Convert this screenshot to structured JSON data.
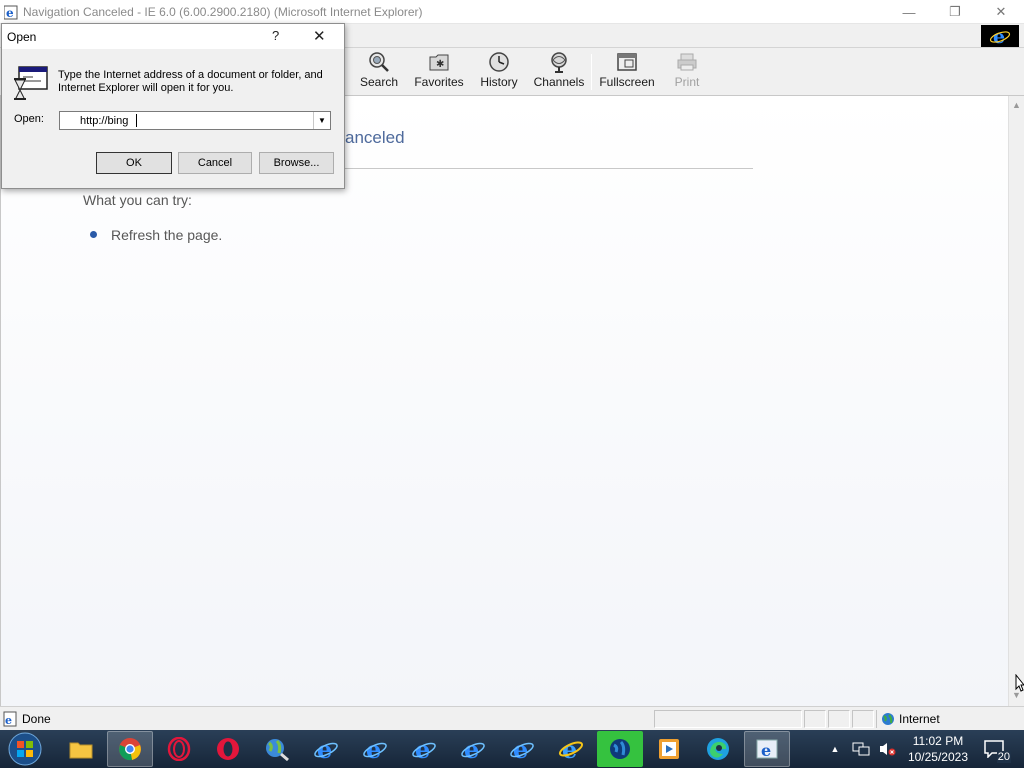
{
  "window": {
    "title": "Navigation Canceled - IE 6.0 (6.00.2900.2180) (Microsoft Internet Explorer)",
    "minimize_glyph": "—",
    "restore_glyph": "❐",
    "close_glyph": "✕"
  },
  "toolbar": {
    "buttons": [
      {
        "label": "Search",
        "icon": "search-icon"
      },
      {
        "label": "Favorites",
        "icon": "favorites-icon"
      },
      {
        "label": "History",
        "icon": "history-icon"
      },
      {
        "label": "Channels",
        "icon": "channels-icon"
      },
      {
        "label": "Fullscreen",
        "icon": "fullscreen-icon"
      },
      {
        "label": "Print",
        "icon": "print-icon",
        "disabled": true
      }
    ]
  },
  "page": {
    "heading_fragment": "anceled",
    "what_you_can_try": "What you can try:",
    "refresh": "Refresh the page."
  },
  "status": {
    "text": "Done",
    "zone": "Internet"
  },
  "taskbar": {
    "time": "11:02 PM",
    "date": "10/25/2023",
    "notification_count": "20"
  },
  "dialog": {
    "title": "Open",
    "help_glyph": "?",
    "close_glyph": "✕",
    "description": "Type the Internet address of a document or folder, and Internet Explorer will open it for you.",
    "open_label": "Open:",
    "open_value": "http://bing",
    "ok_label": "OK",
    "cancel_label": "Cancel",
    "browse_label": "Browse..."
  },
  "colors": {
    "accent": "#4e6a9c",
    "taskbar": "#1e3147",
    "bullet": "#2a5aa8"
  }
}
